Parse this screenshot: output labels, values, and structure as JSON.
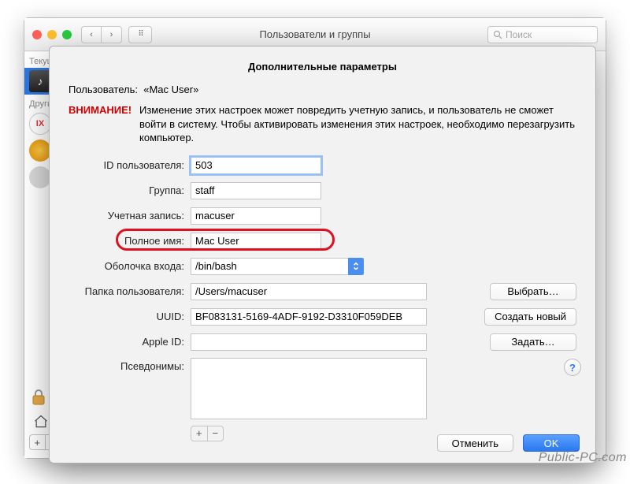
{
  "window": {
    "title": "Пользователи и группы",
    "search_placeholder": "Поиск"
  },
  "sidebar": {
    "current_label": "Текущ",
    "others_label": "Други"
  },
  "sheet": {
    "title": "Дополнительные параметры",
    "user_label": "Пользователь:",
    "user_value": "«Mac User»",
    "warning_label": "ВНИМАНИЕ!",
    "warning_text": "Изменение этих настроек может повредить учетную запись, и пользователь не сможет войти в систему. Чтобы активировать изменения этих настроек, необходимо перезагрузить компьютер.",
    "fields": {
      "user_id_label": "ID пользователя:",
      "user_id_value": "503",
      "group_label": "Группа:",
      "group_value": "staff",
      "account_label": "Учетная запись:",
      "account_value": "macuser",
      "fullname_label": "Полное имя:",
      "fullname_value": "Mac User",
      "shell_label": "Оболочка входа:",
      "shell_value": "/bin/bash",
      "home_label": "Папка пользователя:",
      "home_value": "/Users/macuser",
      "uuid_label": "UUID:",
      "uuid_value": "BF083131-5169-4ADF-9192-D3310F059DEB",
      "appleid_label": "Apple ID:",
      "appleid_value": "",
      "aliases_label": "Псевдонимы:"
    },
    "buttons": {
      "choose": "Выбрать…",
      "create_new": "Создать новый",
      "set": "Задать…",
      "cancel": "Отменить",
      "ok": "OK"
    }
  },
  "watermark": "Public-PC.com"
}
